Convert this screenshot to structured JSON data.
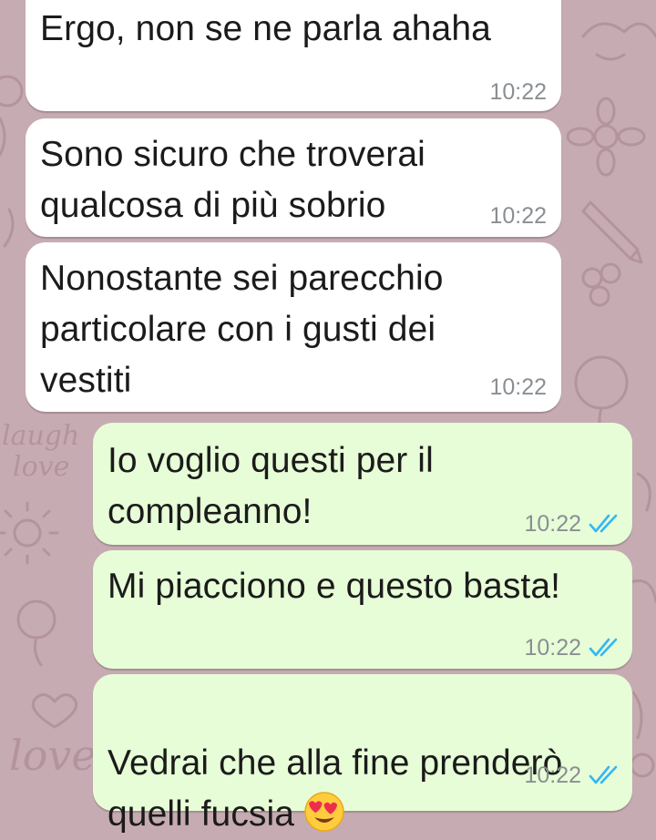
{
  "colors": {
    "wallpaper": "#c7abb2",
    "wallpaper_doodle": "#b4949c",
    "incoming_bubble": "#ffffff",
    "outgoing_bubble": "#e7fdd7",
    "message_text": "#1b1b1b",
    "timestamp": "#8a8f93",
    "read_ticks": "#34b7f1"
  },
  "wallpaper": {
    "doodle_text_1": "laugh",
    "doodle_text_2": "love",
    "doodle_text_3": "love"
  },
  "messages": [
    {
      "direction": "incoming",
      "text": "Ergo, non se ne parla ahaha",
      "time": "10:22"
    },
    {
      "direction": "incoming",
      "text": "Sono sicuro che troverai\nqualcosa di più sobrio",
      "time": "10:22"
    },
    {
      "direction": "incoming",
      "text": "Nonostante sei parecchio\nparticolare con i gusti dei\nvestiti",
      "time": "10:22"
    },
    {
      "direction": "outgoing",
      "text": "Io voglio questi per il\ncompleanno!",
      "time": "10:22",
      "status_icon": "double-check-read-icon"
    },
    {
      "direction": "outgoing",
      "text": "Mi piacciono e questo basta!",
      "time": "10:22",
      "status_icon": "double-check-read-icon"
    },
    {
      "direction": "outgoing",
      "text": "Vedrai che alla fine prenderò\nquelli fucsia",
      "emoji_icon": "smiling-face-with-heart-eyes-icon",
      "time": "10:22",
      "status_icon": "double-check-read-icon"
    }
  ]
}
